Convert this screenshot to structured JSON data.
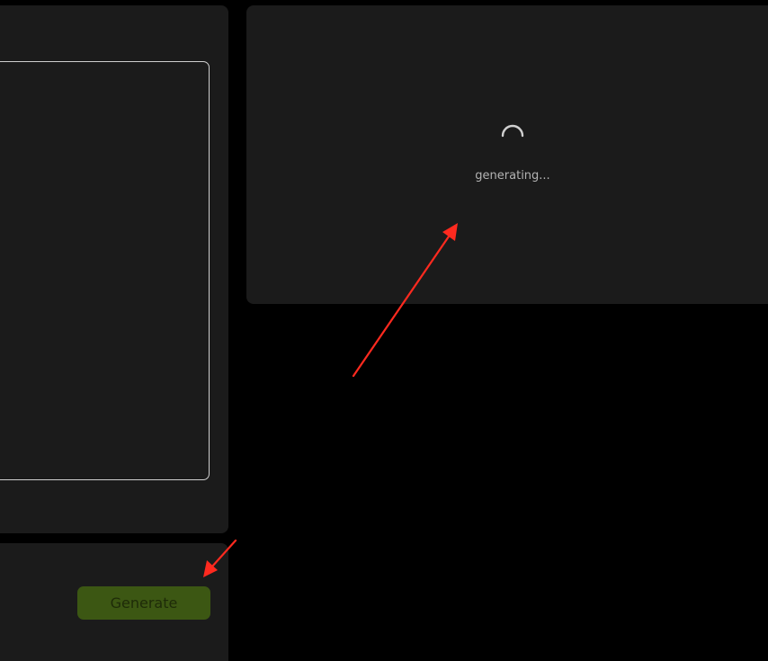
{
  "input_panel": {
    "prompt_value": ""
  },
  "actions_panel": {
    "generate_label": "Generate"
  },
  "output_panel": {
    "status_text": "generating..."
  },
  "annotations": {
    "arrow_color": "#ff2a1f",
    "count": 2
  },
  "colors": {
    "page_background": "#000000",
    "panel_background": "#1b1b1b",
    "button_background": "#3c5713",
    "button_text": "#1e2b08"
  }
}
